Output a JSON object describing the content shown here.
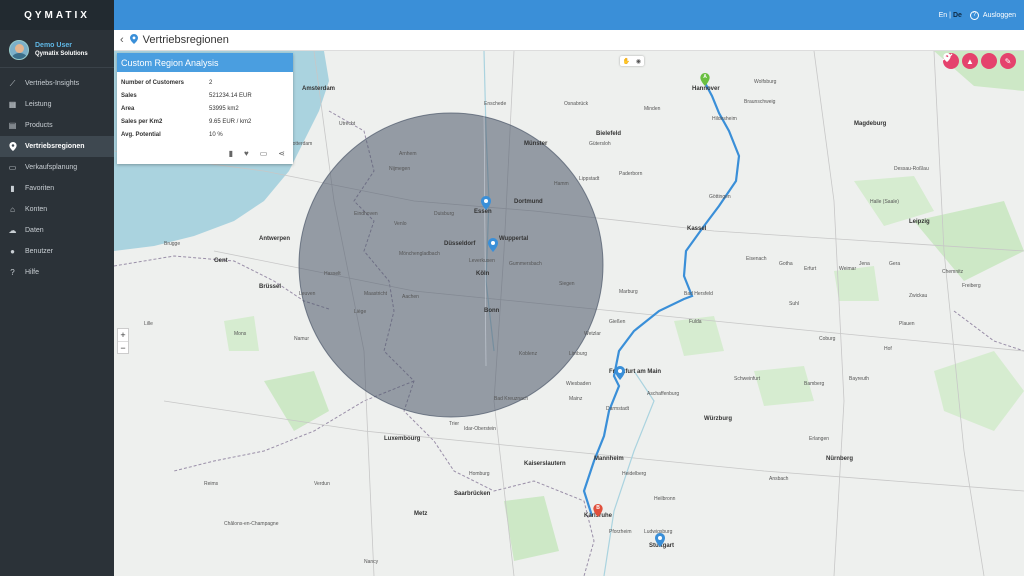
{
  "brand": {
    "logo_text": "QYMATIX"
  },
  "user": {
    "name": "Demo User",
    "company": "Qymatix Solutions"
  },
  "nav": [
    {
      "label": "Vertriebs-Insights",
      "icon": "trend-icon",
      "glyph": "⟋"
    },
    {
      "label": "Leistung",
      "icon": "bar-chart-icon",
      "glyph": "▦"
    },
    {
      "label": "Products",
      "icon": "document-icon",
      "glyph": "▤"
    },
    {
      "label": "Vertriebsregionen",
      "icon": "map-pin-icon",
      "glyph": "⬤",
      "active": true
    },
    {
      "label": "Verkaufsplanung",
      "icon": "calendar-icon",
      "glyph": "▭"
    },
    {
      "label": "Favoriten",
      "icon": "bookmark-icon",
      "glyph": "▮"
    },
    {
      "label": "Konten",
      "icon": "bank-icon",
      "glyph": "⌂"
    },
    {
      "label": "Daten",
      "icon": "cloud-upload-icon",
      "glyph": "☁"
    },
    {
      "label": "Benutzer",
      "icon": "user-icon",
      "glyph": "●"
    },
    {
      "label": "Hilfe",
      "icon": "help-icon",
      "glyph": "?"
    }
  ],
  "topbar": {
    "lang_en": "En",
    "lang_separator": "|",
    "lang_de": "De",
    "logout_label": "Ausloggen"
  },
  "page": {
    "title": "Vertriebsregionen"
  },
  "panel": {
    "title": "Custom Region Analysis",
    "rows": [
      {
        "key": "Number of Customers",
        "value": "2"
      },
      {
        "key": "Sales",
        "value": "521234.14 EUR"
      },
      {
        "key": "Area",
        "value": "53995 km2"
      },
      {
        "key": "Sales per Km2",
        "value": "9.65 EUR / km2"
      },
      {
        "key": "Avg. Potential",
        "value": "10 %"
      }
    ]
  },
  "map": {
    "zoom_in": "+",
    "zoom_out": "−",
    "route_start": "A",
    "route_end": "B",
    "colors": {
      "route": "#3a8fd8",
      "circle": "#4a5568",
      "tools": "#e5426d",
      "marker": "#3a8fd8"
    },
    "labels": {
      "amsterdam": "Amsterdam",
      "hannover": "Hannover",
      "bielefeld": "Bielefeld",
      "munster": "Münster",
      "dortmund": "Dortmund",
      "essen": "Essen",
      "duisburg": "Duisburg",
      "dusseldorf": "Düsseldorf",
      "wuppertal": "Wuppertal",
      "koln": "Köln",
      "bonn": "Bonn",
      "antwerpen": "Antwerpen",
      "brussel": "Brüssel",
      "gent": "Gent",
      "rotterdam": "Rotterdam",
      "kassel": "Kassel",
      "gottingen": "Göttingen",
      "leipzig": "Leipzig",
      "erfurt": "Erfurt",
      "frankfurt": "Frankfurt am Main",
      "wiesbaden": "Wiesbaden",
      "darmstadt": "Darmstadt",
      "mannheim": "Mannheim",
      "heidelberg": "Heidelberg",
      "karlsruhe": "Karlsruhe",
      "stuttgart": "Stuttgart",
      "nurnberg": "Nürnberg",
      "wurzburg": "Würzburg",
      "luxembourg": "Luxembourg",
      "metz": "Metz",
      "saarbrucken": "Saarbrücken",
      "kaiserslautern": "Kaiserslautern",
      "braunschweig": "Braunschweig",
      "wolfsburg": "Wolfsburg",
      "magdeburg": "Magdeburg",
      "halle": "Halle (Saale)",
      "fulda": "Fulda",
      "marburg": "Marburg",
      "siegen": "Siegen",
      "paderborn": "Paderborn",
      "liege": "Liège",
      "aachen": "Aachen",
      "namur": "Namur",
      "heilbronn": "Heilbronn",
      "pforzheim": "Pforzheim",
      "koblenz": "Koblenz",
      "trier": "Trier",
      "giessen": "Gießen",
      "bamberg": "Bamberg",
      "chemnitz": "Chemnitz",
      "zwickau": "Zwickau",
      "plauen": "Plauen",
      "bayreuth": "Bayreuth",
      "erlangen": "Erlangen",
      "jena": "Jena",
      "gera": "Gera",
      "dessau": "Dessau-Roßlau",
      "hildesheim": "Hildesheim",
      "schweinfurt": "Schweinfurt",
      "aschaffenburg": "Aschaffenburg",
      "freiberg": "Freiberg",
      "ansbach": "Ansbach",
      "nancy": "Nancy",
      "mons": "Mons",
      "lille": "Lille",
      "brugge": "Brugge",
      "utrecht": "Utrecht",
      "arnhem": "Arnhem",
      "nijmegen": "Nijmegen",
      "eindhoven": "Eindhoven",
      "venlo": "Venlo",
      "enschede": "Enschede",
      "osnabruck": "Osnabrück",
      "minden": "Minden",
      "hamm": "Hamm",
      "gutersloh": "Gütersloh",
      "lippstadt": "Lippstadt",
      "leverkusen": "Leverkusen",
      "gummersbach": "Gummersbach",
      "monchengladbach": "Mönchengladbach",
      "maastricht": "Maastricht",
      "hasselt": "Hasselt",
      "leuven": "Leuven",
      "reims": "Reims",
      "chalons": "Châlons-en-Champagne",
      "verdun": "Verdun",
      "bad_hersfeld": "Bad Hersfeld",
      "eisenach": "Eisenach",
      "gotha": "Gotha",
      "weimar": "Weimar",
      "suhl": "Suhl",
      "coburg": "Coburg",
      "hof": "Hof",
      "ludwigsburg": "Ludwigsburg",
      "kaiserslautern2": "Homburg",
      "mainz": "Mainz",
      "bad_kreuznach": "Bad Kreuznach",
      "limburg": "Limburg",
      "wetzlar": "Wetzlar",
      "idar": "Idar-Oberstein"
    }
  }
}
